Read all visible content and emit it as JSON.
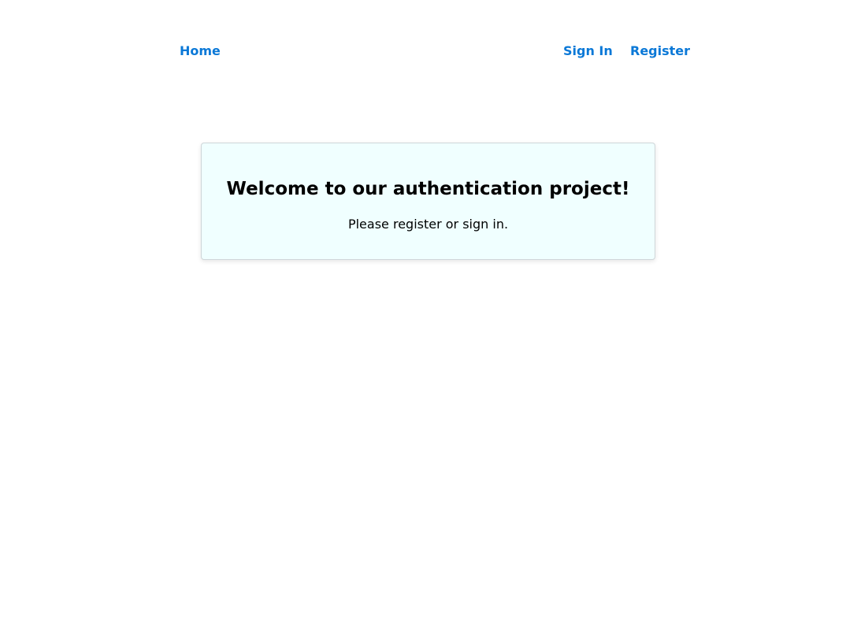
{
  "nav": {
    "home_label": "Home",
    "sign_in_label": "Sign In",
    "register_label": "Register",
    "link_color": "#0a78d7"
  },
  "welcome": {
    "title": "Welcome to our authentication project!",
    "message": "Please register or sign in.",
    "background_color": "#f0ffff"
  }
}
